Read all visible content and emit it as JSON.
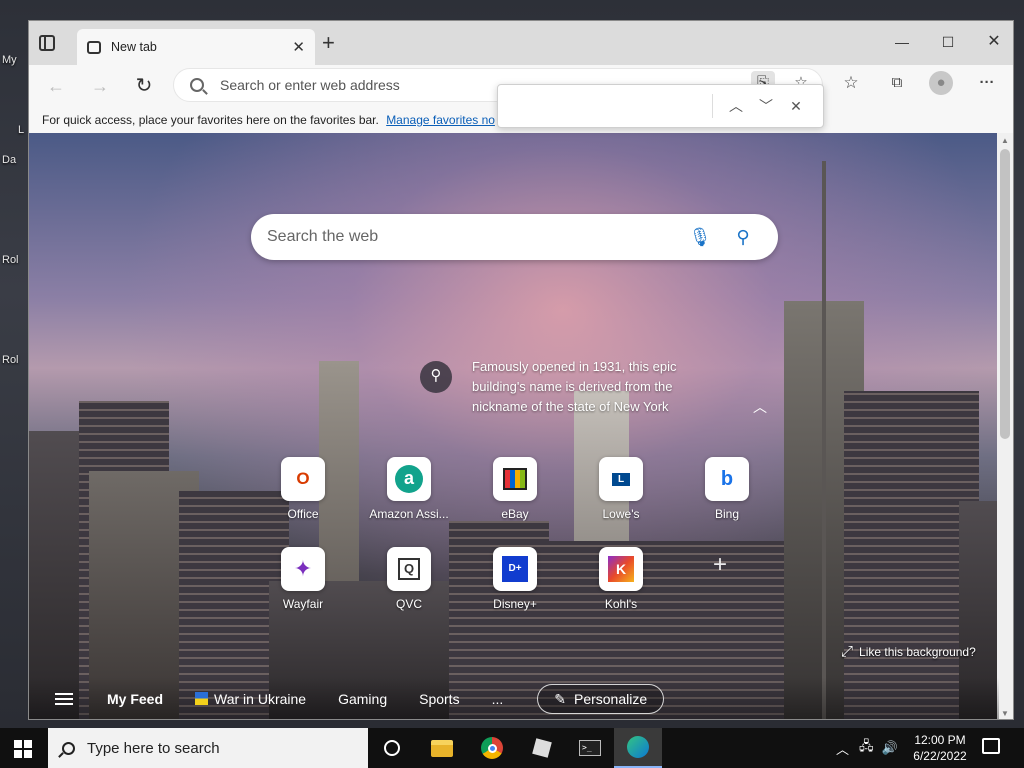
{
  "desktop": {
    "labels": [
      "My",
      "L",
      "Da",
      "Rol",
      "Rol"
    ]
  },
  "browser": {
    "tab": {
      "title": "New tab",
      "close": "✕"
    },
    "new_tab": "+",
    "window_controls": {
      "minimize": "—",
      "maximize": "☐",
      "close": "✕"
    },
    "nav": {
      "back": "←",
      "forward": "→",
      "refresh": "↻"
    },
    "address": {
      "placeholder": "Search or enter web address"
    },
    "toolbar_icons": [
      "read-aloud-icon",
      "add-favorite-icon",
      "favorites-icon",
      "collections-icon",
      "profile-icon",
      "more-icon"
    ],
    "more": "···",
    "favbar": {
      "text": "For quick access, place your favorites here on the favorites bar.",
      "link": "Manage favorites no"
    }
  },
  "findbar": {
    "value": "",
    "prev": "︿",
    "next": "﹀",
    "close": "✕"
  },
  "newtab": {
    "search_placeholder": "Search the web",
    "fact": "Famously opened in 1931, this epic building's name is derived from the nickname of the state of New York",
    "tiles_row1": [
      {
        "label": "Office",
        "glyph": "O",
        "color": "#d83b01"
      },
      {
        "label": "Amazon Assi...",
        "glyph": "a",
        "color": "#12a38c"
      },
      {
        "label": "eBay",
        "glyph": "▮",
        "color": "#e53238"
      },
      {
        "label": "Lowe's",
        "glyph": "L",
        "color": "#004990"
      },
      {
        "label": "Bing",
        "glyph": "b",
        "color": "#1a73e8"
      }
    ],
    "tiles_row2": [
      {
        "label": "Wayfair",
        "glyph": "✦",
        "color": "#7b2fbe"
      },
      {
        "label": "QVC",
        "glyph": "Q",
        "color": "#333333"
      },
      {
        "label": "Disney+",
        "glyph": "D+",
        "color": "#113ccf"
      },
      {
        "label": "Kohl's",
        "glyph": "K",
        "color": "#8b2fc9"
      }
    ],
    "add_site": "+",
    "like_bg": "Like this background?",
    "feed": {
      "my_feed": "My Feed",
      "items": [
        "War in Ukraine",
        "Gaming",
        "Sports"
      ],
      "more": "...",
      "personalize": "Personalize"
    }
  },
  "taskbar": {
    "search_placeholder": "Type here to search",
    "time": "12:00 PM",
    "date": "6/22/2022"
  }
}
